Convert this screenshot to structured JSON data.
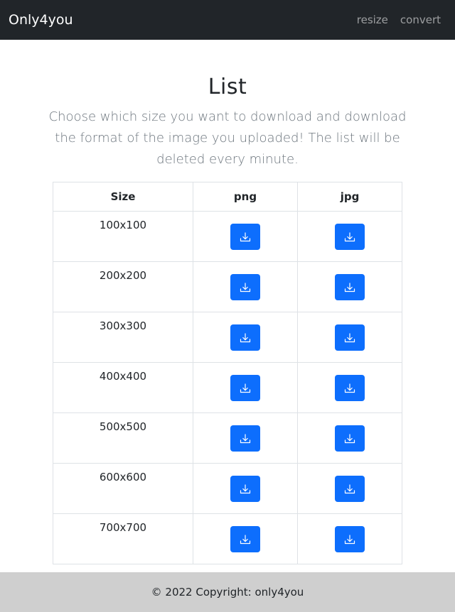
{
  "navbar": {
    "brand": "Only4you",
    "links": [
      "resize",
      "convert"
    ]
  },
  "main": {
    "title": "List",
    "description": "Choose which size you want to download and download the format of the image you uploaded! The list will be deleted every minute."
  },
  "table": {
    "headers": [
      "Size",
      "png",
      "jpg"
    ],
    "rows": [
      {
        "size": "100x100"
      },
      {
        "size": "200x200"
      },
      {
        "size": "300x300"
      },
      {
        "size": "400x400"
      },
      {
        "size": "500x500"
      },
      {
        "size": "600x600"
      },
      {
        "size": "700x700"
      }
    ],
    "download_icon": "download-icon",
    "button_color": "#0d6efd"
  },
  "footer": {
    "text": "© 2022 Copyright: only4you"
  }
}
